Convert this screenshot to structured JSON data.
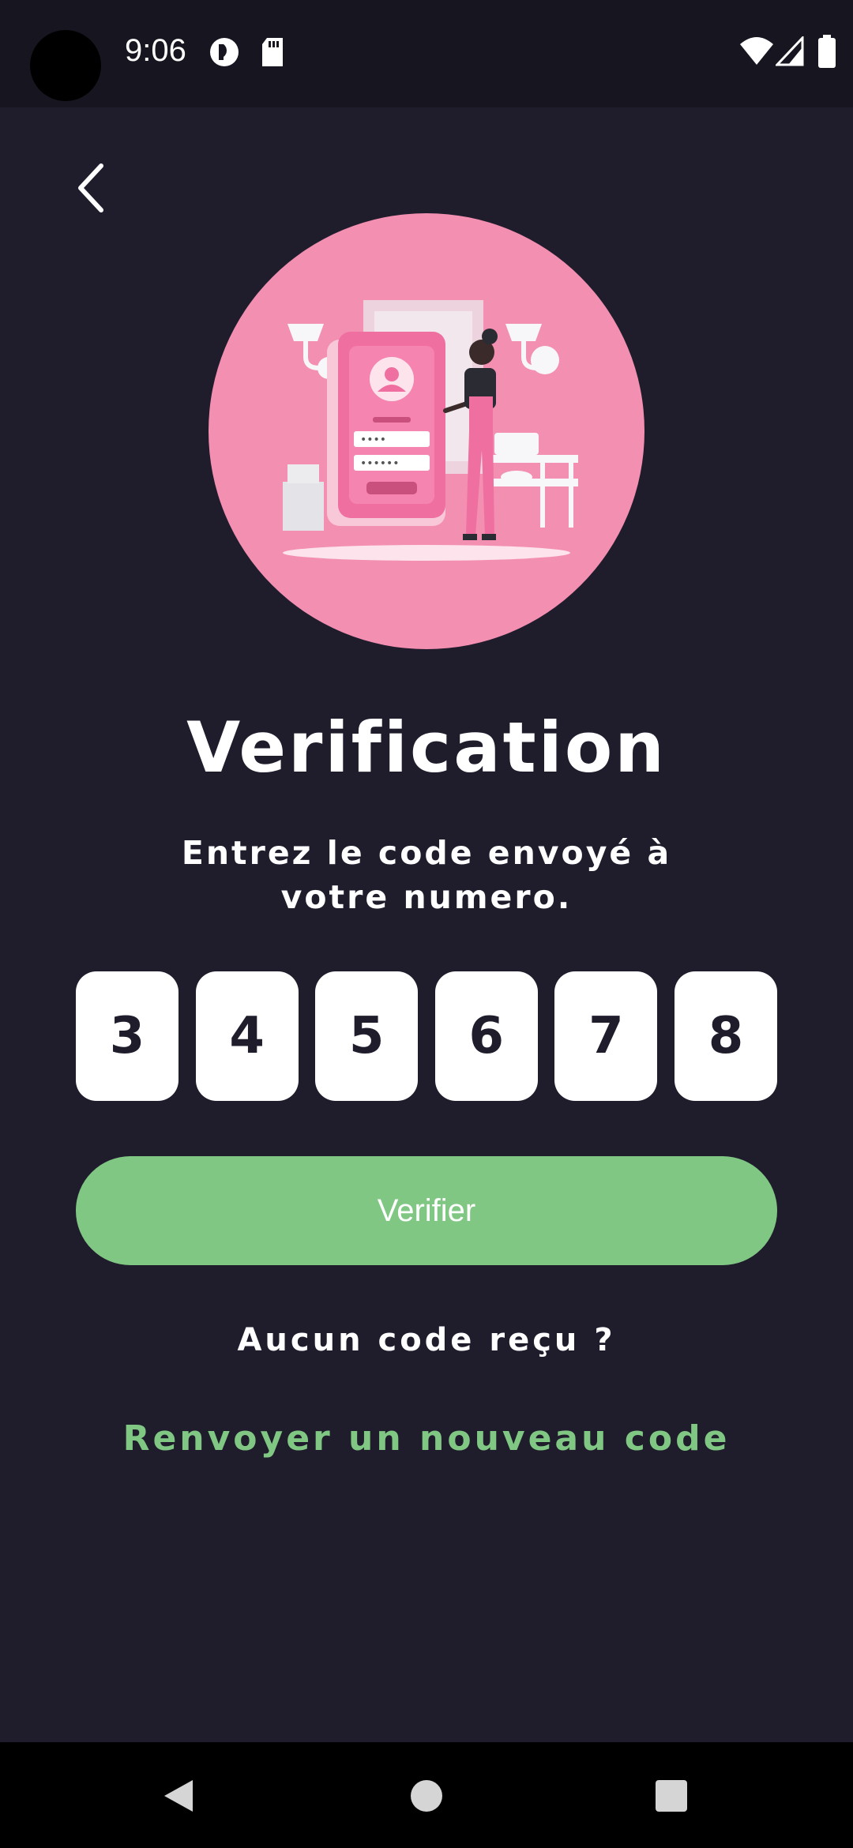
{
  "status_bar": {
    "time": "9:06",
    "icons": [
      "camera-hole",
      "data-saver-icon",
      "sd-card-icon",
      "wifi-icon",
      "signal-icon",
      "battery-icon"
    ]
  },
  "header": {
    "back_icon": "chevron-left-icon"
  },
  "hero": {
    "illustration": "login-illustration",
    "background_color": "#f38fb0"
  },
  "content": {
    "title": "Verification",
    "subtitle": "Entrez le code envoyé à votre numero.",
    "otp_digits": [
      "3",
      "4",
      "5",
      "6",
      "7",
      "8"
    ],
    "verify_label": "Verifier",
    "no_code_text": "Aucun code reçu ?",
    "resend_label": "Renvoyer un nouveau code"
  },
  "colors": {
    "background": "#1f1c2c",
    "accent": "#81c784",
    "otp_box": "#ffffff"
  },
  "nav_bar": {
    "icons": [
      "back-triangle-icon",
      "home-circle-icon",
      "recents-square-icon"
    ]
  }
}
